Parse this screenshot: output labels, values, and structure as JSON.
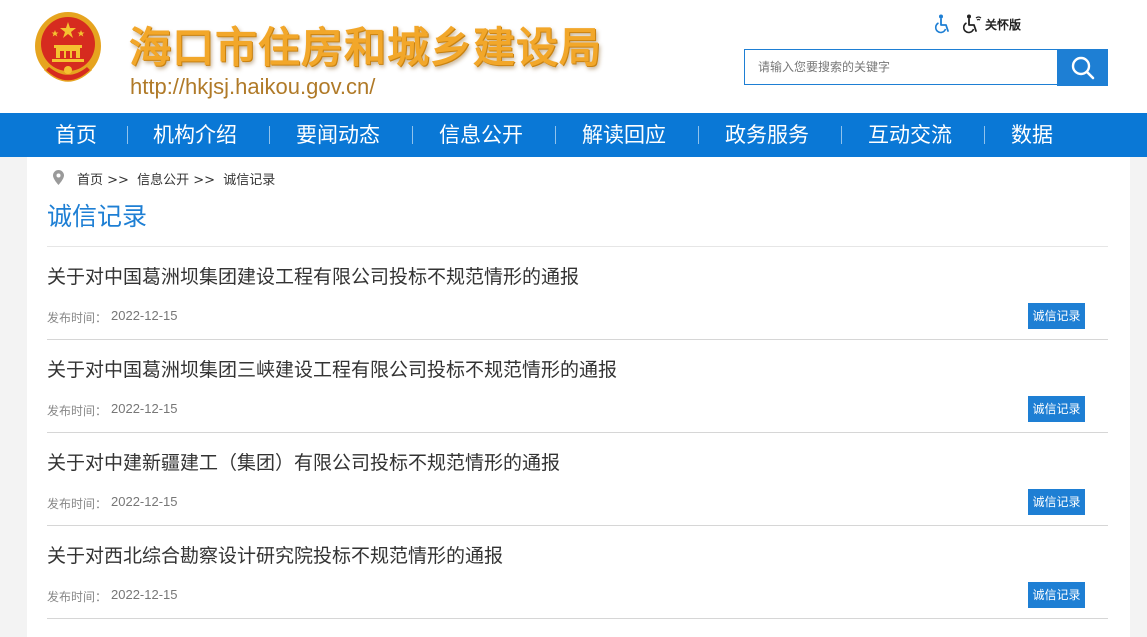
{
  "header": {
    "site_title": "海口市住房和城乡建设局",
    "site_url": "http://hkjsj.haikou.gov.cn/",
    "accessibility_icon": "wheelchair-accessibility-icon",
    "care_mode_icon": "elderly-care-icon",
    "care_mode_label": "关怀版",
    "search": {
      "placeholder": "请输入您要搜索的关键字",
      "value": "",
      "button_icon": "search-icon"
    }
  },
  "nav": {
    "items": [
      "首页",
      "机构介绍",
      "要闻动态",
      "信息公开",
      "解读回应",
      "政务服务",
      "互动交流",
      "数据"
    ]
  },
  "breadcrumb": {
    "icon": "location-pin-icon",
    "items": [
      "首页",
      "信息公开",
      "诚信记录"
    ],
    "separator": ">>"
  },
  "page_title": "诚信记录",
  "list": [
    {
      "title": "关于对中国葛洲坝集团建设工程有限公司投标不规范情形的通报",
      "date_label": "发布时间：",
      "date": "2022-12-15",
      "tag": "诚信记录"
    },
    {
      "title": "关于对中国葛洲坝集团三峡建设工程有限公司投标不规范情形的通报",
      "date_label": "发布时间：",
      "date": "2022-12-15",
      "tag": "诚信记录"
    },
    {
      "title": "关于对中建新疆建工（集团）有限公司投标不规范情形的通报",
      "date_label": "发布时间：",
      "date": "2022-12-15",
      "tag": "诚信记录"
    },
    {
      "title": "关于对西北综合勘察设计研究院投标不规范情形的通报",
      "date_label": "发布时间：",
      "date": "2022-12-15",
      "tag": "诚信记录"
    }
  ],
  "colors": {
    "primary_blue": "#0a78d6",
    "title_orange": "#f2a72a",
    "url_brown": "#b07a28",
    "emblem_red": "#d62b1f",
    "emblem_gold": "#f5c230"
  }
}
